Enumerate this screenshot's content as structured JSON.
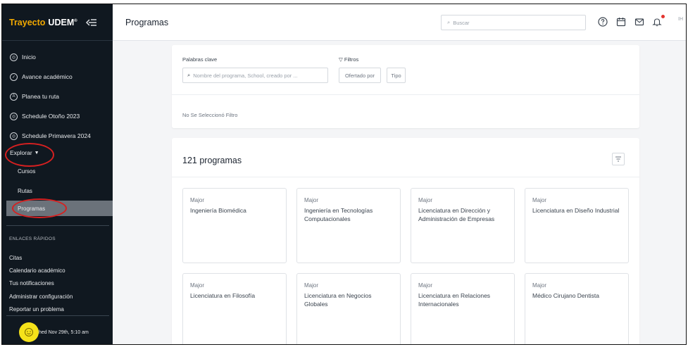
{
  "brand": {
    "name": "Trayecto",
    "org": "UDEM",
    "tm": "®"
  },
  "header": {
    "title": "Programas",
    "search_placeholder": "Buscar",
    "user_initials": "IH"
  },
  "sidebar": {
    "nav": [
      {
        "label": "Inicio",
        "icon": "home-circle-icon"
      },
      {
        "label": "Avance académico",
        "icon": "check-circle-icon"
      },
      {
        "label": "Planea tu ruta",
        "icon": "route-circle-icon"
      },
      {
        "label": "Schedule Otoño 2023",
        "icon": "schedule-circle-icon"
      },
      {
        "label": "Schedule Primavera 2024",
        "icon": "schedule-circle-icon"
      }
    ],
    "explore": {
      "label": "Explorar",
      "items": [
        "Cursos",
        "Rutas",
        "Programas"
      ],
      "active": "Programas"
    },
    "quick_links_title": "ENLACES RÁPIDOS",
    "quick_links": [
      "Citas",
      "Calendario académico",
      "Tus notificaciones",
      "Administrar configuración",
      "Reportar un problema"
    ],
    "footer_text": "Updated Nov 29th, 5:10 am",
    "footer_text_visible": "hed Nov 29th, 5:10 am"
  },
  "filters": {
    "keywords_label": "Palabras clave",
    "keywords_placeholder": "Nombre del programa, School, creado por ...",
    "filters_label": "Filtros",
    "chips": [
      "Ofertado por",
      "Tipo"
    ],
    "no_filter_text": "No Se Seleccionó Filtro"
  },
  "programs": {
    "count_label": "121 programas",
    "cards": [
      {
        "type": "Major",
        "name": "Ingeniería Biomédica"
      },
      {
        "type": "Major",
        "name": "Ingeniería en Tecnologías Computacionales"
      },
      {
        "type": "Major",
        "name": "Licenciatura en Dirección y Administración de Empresas"
      },
      {
        "type": "Major",
        "name": "Licenciatura en Diseño Industrial"
      },
      {
        "type": "Major",
        "name": "Licenciatura en Filosofía"
      },
      {
        "type": "Major",
        "name": "Licenciatura en Negocios Globales"
      },
      {
        "type": "Major",
        "name": "Licenciatura en Relaciones Internacionales"
      },
      {
        "type": "Major",
        "name": "Médico Cirujano Dentista"
      }
    ]
  },
  "colors": {
    "sidebar_bg": "#101820",
    "brand_accent": "#f2a900",
    "annotation_red": "#d62020",
    "avatar_yellow": "#f5e21a"
  }
}
